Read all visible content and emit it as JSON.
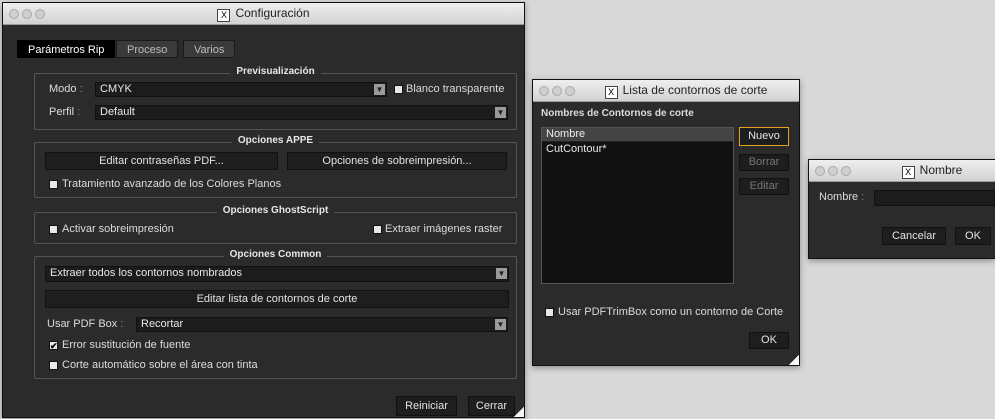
{
  "config_window": {
    "title": "Configuración",
    "tabs": [
      "Parámetros Rip",
      "Proceso",
      "Varios"
    ],
    "preview": {
      "legend": "Previsualización",
      "mode_label": "Modo",
      "mode_value": "CMYK",
      "transparent_white_label": "Blanco transparente",
      "profile_label": "Perfil",
      "profile_value": "Default"
    },
    "appe": {
      "legend": "Opciones APPE",
      "edit_passwords": "Editar contraseñas PDF...",
      "overprint_options": "Opciones de sobreimpresión...",
      "advanced_spot": "Tratamiento avanzado de los Colores Planos"
    },
    "ghostscript": {
      "legend": "Opciones GhostScript",
      "activate_overprint": "Activar sobreimpresión",
      "extract_raster": "Extraer imágenes raster"
    },
    "common": {
      "legend": "Opciones Common",
      "extract_contours": "Extraer todos los contornos nombrados",
      "edit_contour_list": "Editar lista de contornos de corte",
      "use_pdf_box_label": "Usar PDF Box",
      "use_pdf_box_value": "Recortar",
      "font_substitution": "Error sustitución de fuente",
      "auto_cut": "Corte automático sobre el área con tinta"
    },
    "reset_button": "Reiniciar",
    "close_button": "Cerrar"
  },
  "contours_window": {
    "title": "Lista de contornos de corte",
    "heading": "Nombres de Contornos de corte",
    "list_header": "Nombre",
    "items": [
      "CutContour*"
    ],
    "new_button": "Nuevo",
    "delete_button": "Borrar",
    "edit_button": "Editar",
    "trimbox_label": "Usar PDFTrimBox como un contorno de Corte",
    "ok_button": "OK"
  },
  "name_window": {
    "title": "Nombre",
    "name_label": "Nombre",
    "cancel_button": "Cancelar",
    "ok_button": "OK"
  },
  "colors": {
    "window_bg": "#2b2b2b",
    "focus_border": "#e6a11f",
    "desktop_bg": "#d8d8d8"
  }
}
